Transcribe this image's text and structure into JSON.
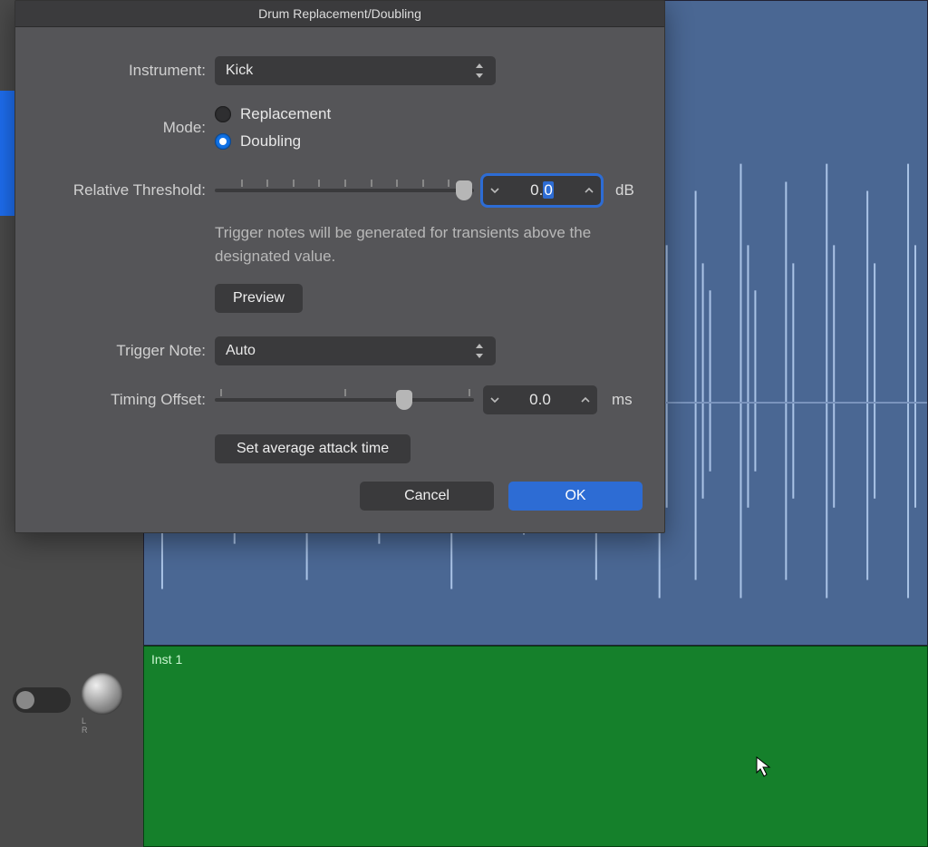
{
  "dialog": {
    "title": "Drum Replacement/Doubling",
    "instrument_label": "Instrument:",
    "instrument_value": "Kick",
    "mode_label": "Mode:",
    "mode_options": {
      "replacement": "Replacement",
      "doubling": "Doubling"
    },
    "mode_selected": "doubling",
    "threshold_label": "Relative Threshold:",
    "threshold_value": "0.0",
    "threshold_unit": "dB",
    "threshold_help": "Trigger notes will be generated for transients above the designated value.",
    "preview_label": "Preview",
    "trigger_label": "Trigger Note:",
    "trigger_value": "Auto",
    "offset_label": "Timing Offset:",
    "offset_value": "0.0",
    "offset_unit": "ms",
    "set_attack_label": "Set average attack time",
    "cancel_label": "Cancel",
    "ok_label": "OK"
  },
  "tracks": {
    "green_region_label": "Inst 1",
    "pan_label": "L   R"
  }
}
